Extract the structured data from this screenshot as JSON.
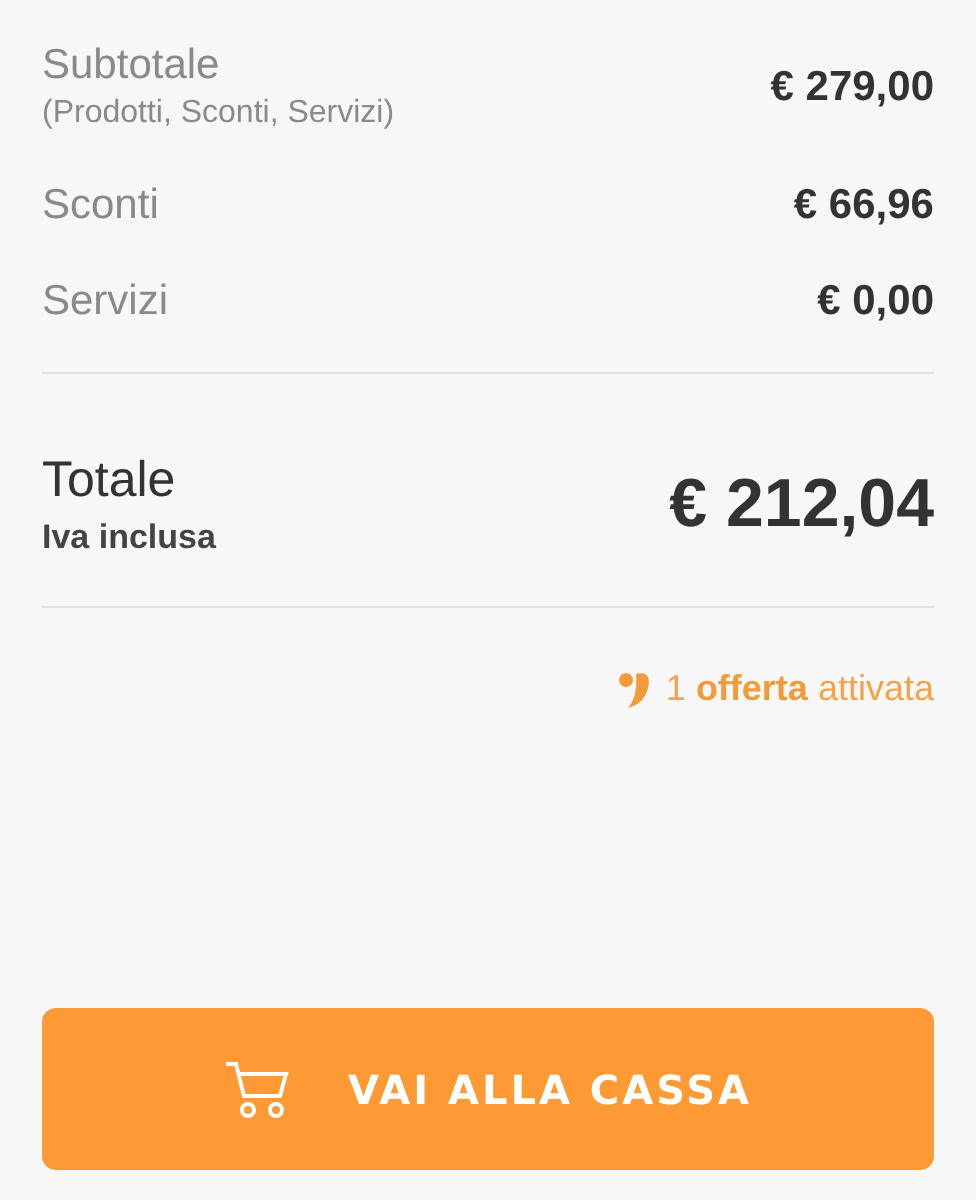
{
  "summary_rows": [
    {
      "label": "Subtotale",
      "note": "(Prodotti, Sconti, Servizi)",
      "amount": "€ 279,00"
    },
    {
      "label": "Sconti",
      "amount": "€ 66,96"
    },
    {
      "label": "Servizi",
      "amount": "€ 0,00"
    }
  ],
  "total": {
    "label": "Totale",
    "note": "Iva inclusa",
    "amount": "€ 212,04"
  },
  "offer": {
    "text": "1 **offerta** attivata"
  },
  "checkout_button": {
    "label": "VAI ALLA CASSA"
  }
}
